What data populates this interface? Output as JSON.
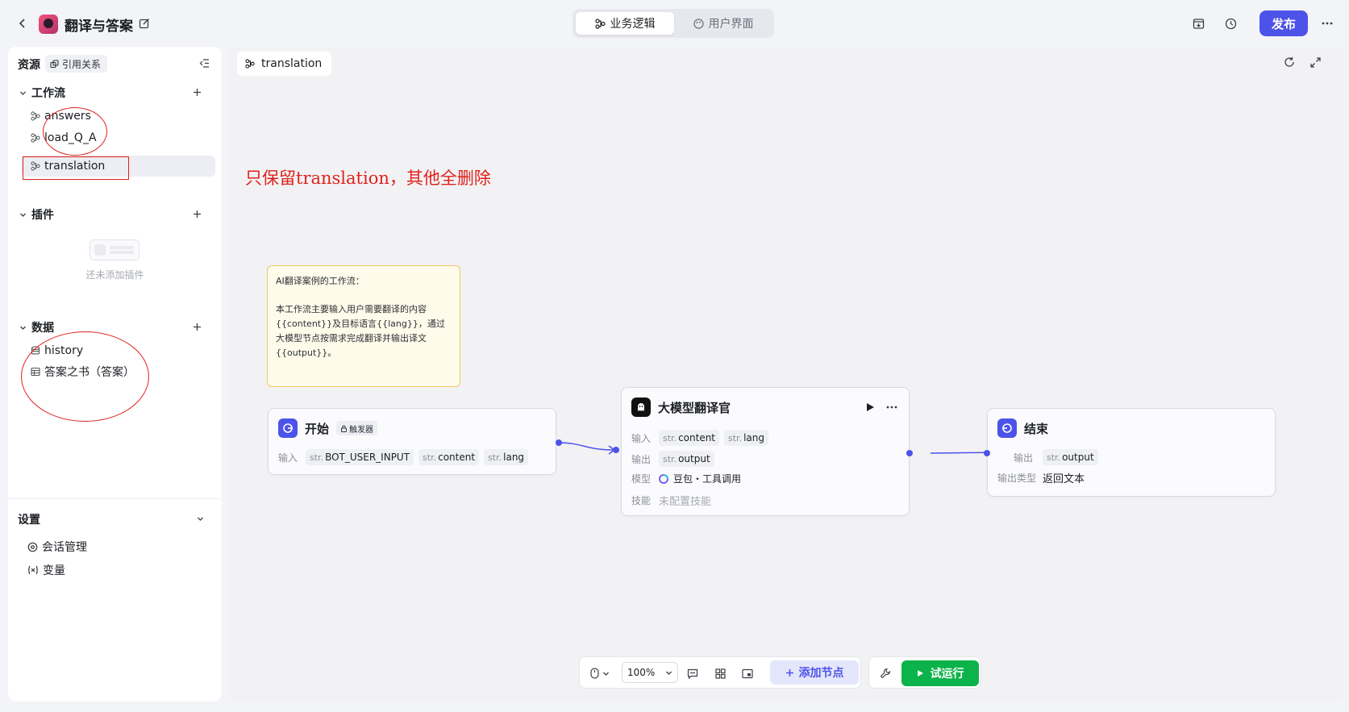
{
  "header": {
    "app_title": "翻译与答案",
    "tabs": [
      {
        "label": "业务逻辑",
        "active": true
      },
      {
        "label": "用户界面",
        "active": false
      }
    ],
    "publish_label": "发布"
  },
  "sidebar": {
    "resources_label": "资源",
    "references_label": "引用关系",
    "workflow": {
      "title": "工作流",
      "items": [
        {
          "label": "answers"
        },
        {
          "label": "load_Q_A"
        },
        {
          "label": "translation",
          "selected": true
        }
      ]
    },
    "plugins": {
      "title": "插件",
      "empty_text": "还未添加插件"
    },
    "data": {
      "title": "数据",
      "items": [
        {
          "label": "history"
        },
        {
          "label": "答案之书（答案）"
        }
      ]
    },
    "settings": {
      "title": "设置",
      "items": [
        {
          "label": "会话管理"
        },
        {
          "label": "变量"
        }
      ]
    }
  },
  "canvas": {
    "tab_label": "translation",
    "annotation": "只保留translation，其他全删除",
    "note": {
      "title": "AI翻译案例的工作流：",
      "body": "本工作流主要输入用户需要翻译的内容{{content}}及目标语言{{lang}}，通过大模型节点按需求完成翻译并输出译文{{output}}。"
    },
    "nodes": {
      "start": {
        "title": "开始",
        "badge": "触发器",
        "input_label": "输入",
        "inputs": [
          {
            "type": "str.",
            "name": "BOT_USER_INPUT"
          },
          {
            "type": "str.",
            "name": "content"
          },
          {
            "type": "str.",
            "name": "lang"
          }
        ]
      },
      "llm": {
        "title": "大模型翻译官",
        "input_label": "输入",
        "inputs": [
          {
            "type": "str.",
            "name": "content"
          },
          {
            "type": "str.",
            "name": "lang"
          }
        ],
        "output_label": "输出",
        "outputs": [
          {
            "type": "str.",
            "name": "output"
          }
        ],
        "model_label": "模型",
        "model_value": "豆包・工具调用",
        "skill_label": "技能",
        "skill_value": "未配置技能"
      },
      "end": {
        "title": "结束",
        "output_label": "输出",
        "outputs": [
          {
            "type": "str.",
            "name": "output"
          }
        ],
        "output_type_label": "输出类型",
        "output_type_value": "返回文本"
      }
    }
  },
  "toolbar": {
    "zoom": "100%",
    "add_node_label": "添加节点",
    "run_label": "试运行"
  },
  "colors": {
    "accent": "#4d53e8",
    "run_green": "#0cb34b",
    "annotation_red": "#e0211b",
    "note_bg": "#fffbea"
  }
}
